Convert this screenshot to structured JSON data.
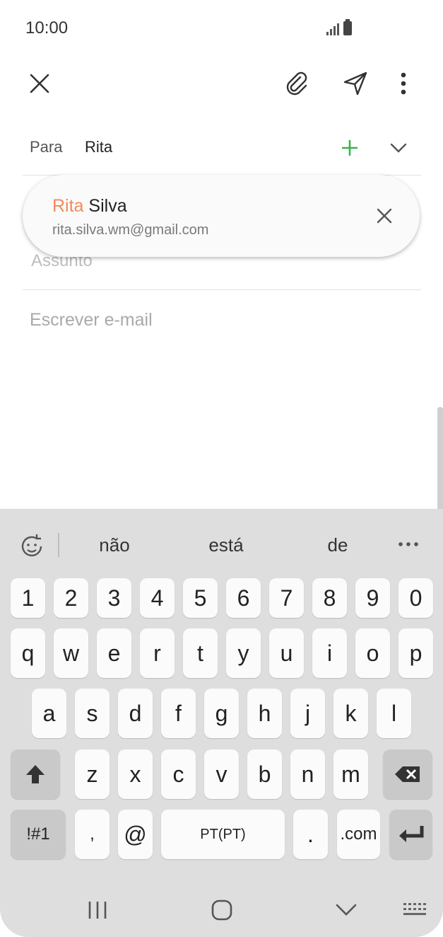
{
  "status": {
    "time": "10:00"
  },
  "compose": {
    "to_label": "Para",
    "to_value": "Rita",
    "subject_placeholder": "Assunto",
    "body_placeholder": "Escrever e-mail"
  },
  "suggestion": {
    "name_match": "Rita",
    "name_rest": " Silva",
    "email": "rita.silva.wm@gmail.com"
  },
  "icons": [
    "close-icon",
    "attach-icon",
    "send-icon",
    "more-icon",
    "add-icon",
    "chevron-down-icon",
    "clear-icon"
  ],
  "colors": {
    "accent_green": "#3cb34a",
    "highlight_orange": "#f5895a"
  },
  "keyboard": {
    "suggestions": [
      "não",
      "está",
      "de"
    ],
    "row_numbers": [
      "1",
      "2",
      "3",
      "4",
      "5",
      "6",
      "7",
      "8",
      "9",
      "0"
    ],
    "row1": [
      "q",
      "w",
      "e",
      "r",
      "t",
      "y",
      "u",
      "i",
      "o",
      "p"
    ],
    "row2": [
      "a",
      "s",
      "d",
      "f",
      "g",
      "h",
      "j",
      "k",
      "l"
    ],
    "row3": [
      "z",
      "x",
      "c",
      "v",
      "b",
      "n",
      "m"
    ],
    "symbols_label": "!#1",
    "comma": ",",
    "at": "@",
    "space_label": "PT(PT)",
    "period": ".",
    "dotcom": ".com"
  }
}
